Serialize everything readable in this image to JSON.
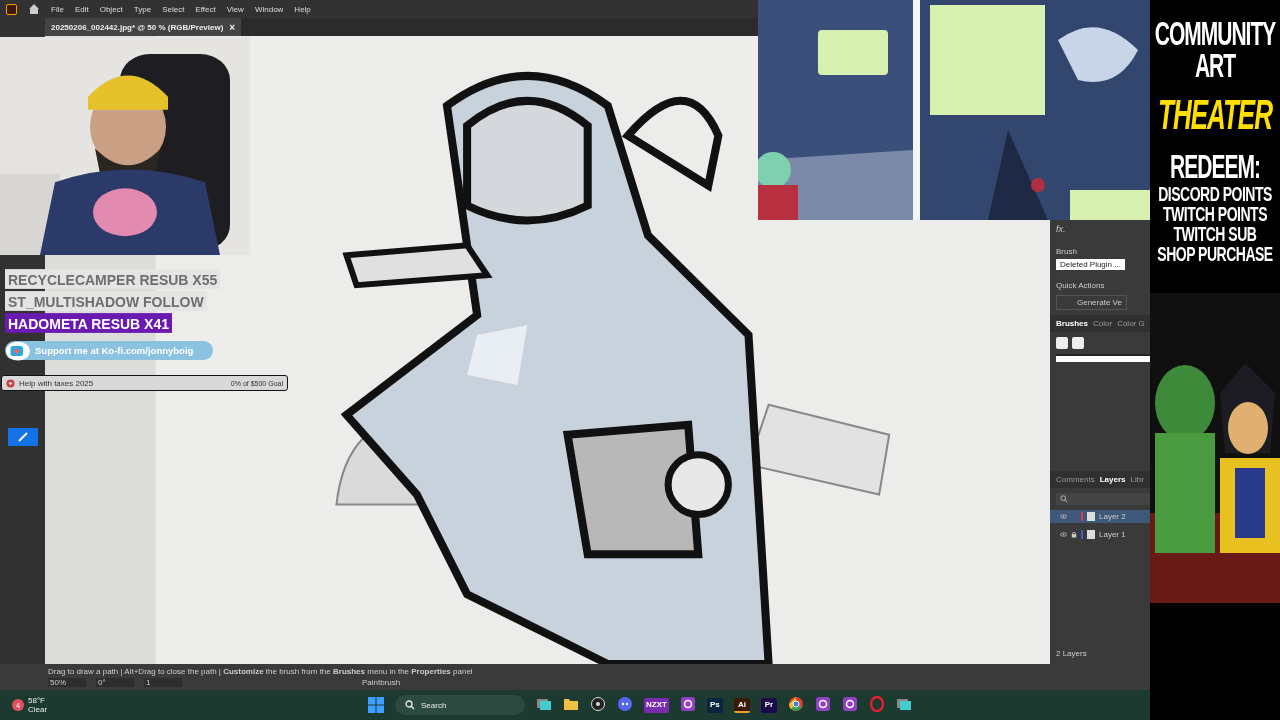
{
  "app": {
    "menu": [
      "File",
      "Edit",
      "Object",
      "Type",
      "Select",
      "Effect",
      "View",
      "Window",
      "Help"
    ],
    "document_tab": {
      "title": "20250206_002442.jpg* @ 50 % (RGB/Preview)",
      "close": "×"
    }
  },
  "alerts": [
    {
      "text": "RECYCLECAMPER  RESUB X55",
      "kind": "faded"
    },
    {
      "text": "ST_MULTISHADOW  FOLLOW",
      "kind": "faded"
    },
    {
      "text": "HADOMETA  RESUB X41",
      "kind": "highlight"
    }
  ],
  "kofi": {
    "text": "Support me at Ko-fi.com/jonnyboig"
  },
  "goal": {
    "label": "Help with taxes 2025",
    "reading": "0% of $500 Goal",
    "level": 0
  },
  "properties": {
    "fx": "fx.",
    "brush_label": "Brush",
    "brush_value": "Deleted Plugin ...",
    "quick_actions": "Quick Actions",
    "generate": "Generate Ve",
    "tabs": [
      {
        "label": "Brushes",
        "selected": true
      },
      {
        "label": "Color",
        "selected": false
      },
      {
        "label": "Color G",
        "selected": false
      }
    ]
  },
  "layers_panel": {
    "tabs": [
      {
        "label": "Comments",
        "selected": false
      },
      {
        "label": "Layers",
        "selected": true
      },
      {
        "label": "Libr",
        "selected": false
      }
    ],
    "layers": [
      {
        "name": "Layer 2",
        "color": "#d04050",
        "selected": true,
        "locked": false
      },
      {
        "name": "Layer 1",
        "color": "#4060d0",
        "selected": false,
        "locked": true
      }
    ],
    "count": "2 Layers"
  },
  "status": {
    "hint": "Drag to draw a path  |  Alt+Drag to close the path  |  **Customize** the brush from the **Brushes** menu in the **Properties** panel",
    "zoom": "50%",
    "angle": "0°",
    "artboard": "1",
    "tool": "Paintbrush"
  },
  "taskbar": {
    "weather": {
      "badge": "4",
      "temp": "58°F",
      "condition": "Clear"
    },
    "search": "Search",
    "apps": [
      {
        "kind": "tile",
        "active": false
      },
      {
        "kind": "folder",
        "active": false
      },
      {
        "kind": "obs",
        "active": false
      },
      {
        "kind": "discord",
        "active": false
      },
      {
        "kind": "label",
        "label": "NZXT",
        "color": "#7a2bb0",
        "active": false
      },
      {
        "kind": "ring",
        "active": false
      },
      {
        "kind": "label",
        "label": "Ps",
        "color": "#0a2540",
        "active": false
      },
      {
        "kind": "label",
        "label": "Ai",
        "color": "#3a1a00",
        "active": true
      },
      {
        "kind": "label",
        "label": "Pr",
        "color": "#1a0a4a",
        "active": false
      },
      {
        "kind": "chrome",
        "active": false
      },
      {
        "kind": "ring",
        "active": false
      },
      {
        "kind": "ring",
        "active": false
      },
      {
        "kind": "opera",
        "active": false
      },
      {
        "kind": "tile",
        "active": false
      }
    ]
  },
  "stream_panel": {
    "lines": [
      {
        "text": "COMMUNITY",
        "kind": "title"
      },
      {
        "text": "ART",
        "kind": "title"
      },
      {
        "text": "THEATER",
        "kind": "accent"
      },
      {
        "text": "REDEEM:",
        "kind": "title"
      },
      {
        "text": "DISCORD POINTS",
        "kind": "item"
      },
      {
        "text": "TWITCH POINTS",
        "kind": "item"
      },
      {
        "text": "TWITCH SUB",
        "kind": "item"
      },
      {
        "text": "SHOP PURCHASE",
        "kind": "item"
      }
    ]
  }
}
